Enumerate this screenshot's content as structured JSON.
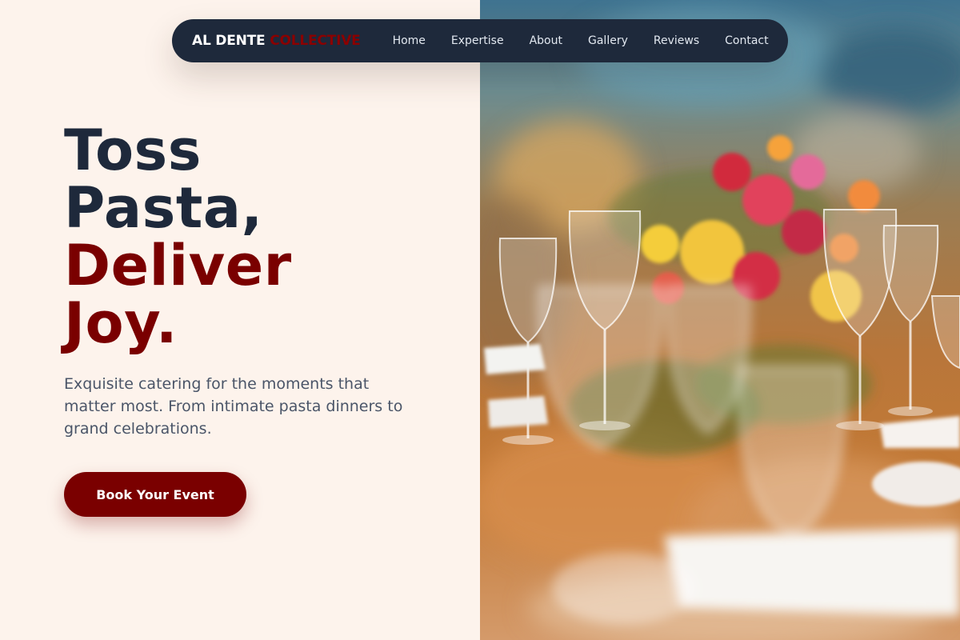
{
  "brand": {
    "name_main": "AL DENTE",
    "name_accent": "COLLECTIVE"
  },
  "nav": {
    "items": [
      {
        "label": "Home"
      },
      {
        "label": "Expertise"
      },
      {
        "label": "About"
      },
      {
        "label": "Gallery"
      },
      {
        "label": "Reviews"
      },
      {
        "label": "Contact"
      }
    ]
  },
  "hero": {
    "headline_line1": "Toss",
    "headline_line2": "Pasta,",
    "headline_line3": "Deliver",
    "headline_line4": "Joy.",
    "subtext": "Exquisite catering for the moments that matter most. From intimate pasta dinners to grand celebrations.",
    "cta_label": "Book Your Event",
    "image_alt": "Elegant catering table setting with floral centerpiece and wine glasses"
  },
  "colors": {
    "navy": "#1e293b",
    "brand_red": "#7a0000",
    "background": "#fdf3ec",
    "body_text": "#4a5568"
  }
}
